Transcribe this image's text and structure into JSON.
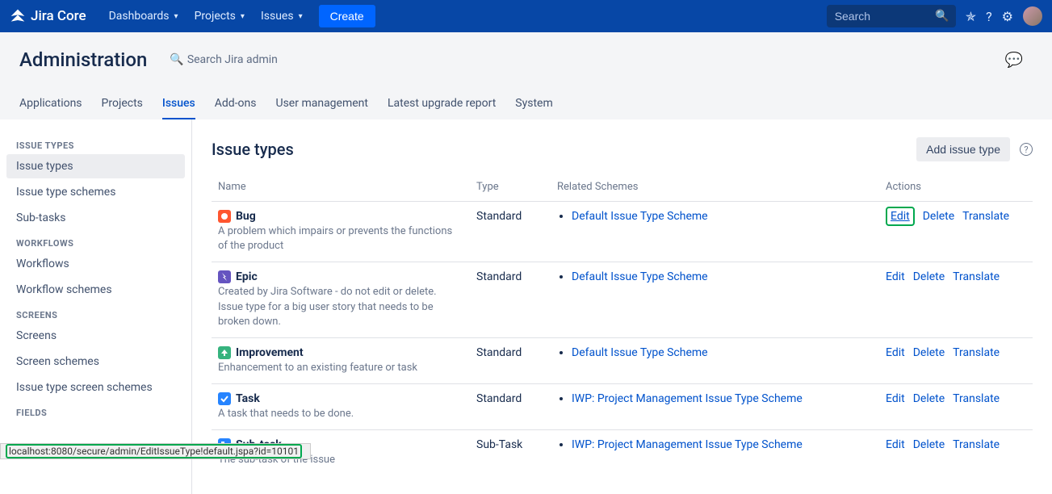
{
  "topnav": {
    "product": "Jira Core",
    "items": [
      "Dashboards",
      "Projects",
      "Issues"
    ],
    "create": "Create",
    "search_placeholder": "Search"
  },
  "admin": {
    "title": "Administration",
    "search_placeholder": "Search Jira admin",
    "tabs": [
      "Applications",
      "Projects",
      "Issues",
      "Add-ons",
      "User management",
      "Latest upgrade report",
      "System"
    ],
    "active_tab": "Issues"
  },
  "sidebar": {
    "sections": [
      {
        "title": "ISSUE TYPES",
        "items": [
          "Issue types",
          "Issue type schemes",
          "Sub-tasks"
        ],
        "active": "Issue types"
      },
      {
        "title": "WORKFLOWS",
        "items": [
          "Workflows",
          "Workflow schemes"
        ]
      },
      {
        "title": "SCREENS",
        "items": [
          "Screens",
          "Screen schemes",
          "Issue type screen schemes"
        ]
      },
      {
        "title": "FIELDS",
        "items": []
      }
    ]
  },
  "main": {
    "title": "Issue types",
    "add_button": "Add issue type",
    "columns": {
      "name": "Name",
      "type": "Type",
      "schemes": "Related Schemes",
      "actions": "Actions"
    },
    "action_labels": {
      "edit": "Edit",
      "delete": "Delete",
      "translate": "Translate"
    },
    "rows": [
      {
        "icon": "bug",
        "icon_bg": "#FF5630",
        "name": "Bug",
        "desc": "A problem which impairs or prevents the functions of the product",
        "type": "Standard",
        "schemes": [
          "Default Issue Type Scheme"
        ],
        "edit_highlighted": true
      },
      {
        "icon": "epic",
        "icon_bg": "#6554C0",
        "name": "Epic",
        "desc": "Created by Jira Software - do not edit or delete. Issue type for a big user story that needs to be broken down.",
        "type": "Standard",
        "schemes": [
          "Default Issue Type Scheme"
        ]
      },
      {
        "icon": "improvement",
        "icon_bg": "#36B37E",
        "name": "Improvement",
        "desc": "Enhancement to an existing feature or task",
        "type": "Standard",
        "schemes": [
          "Default Issue Type Scheme"
        ]
      },
      {
        "icon": "task",
        "icon_bg": "#2684FF",
        "name": "Task",
        "desc": "A task that needs to be done.",
        "type": "Standard",
        "schemes": [
          "IWP: Project Management Issue Type Scheme"
        ]
      },
      {
        "icon": "subtask",
        "icon_bg": "#2684FF",
        "name": "Sub-task",
        "desc": "The sub-task of the issue",
        "type": "Sub-Task",
        "schemes": [
          "IWP: Project Management Issue Type Scheme"
        ]
      }
    ]
  },
  "status_url_highlighted": "localhost:8080/secure/admin/EditIssueType!default.jspa?id=10101"
}
